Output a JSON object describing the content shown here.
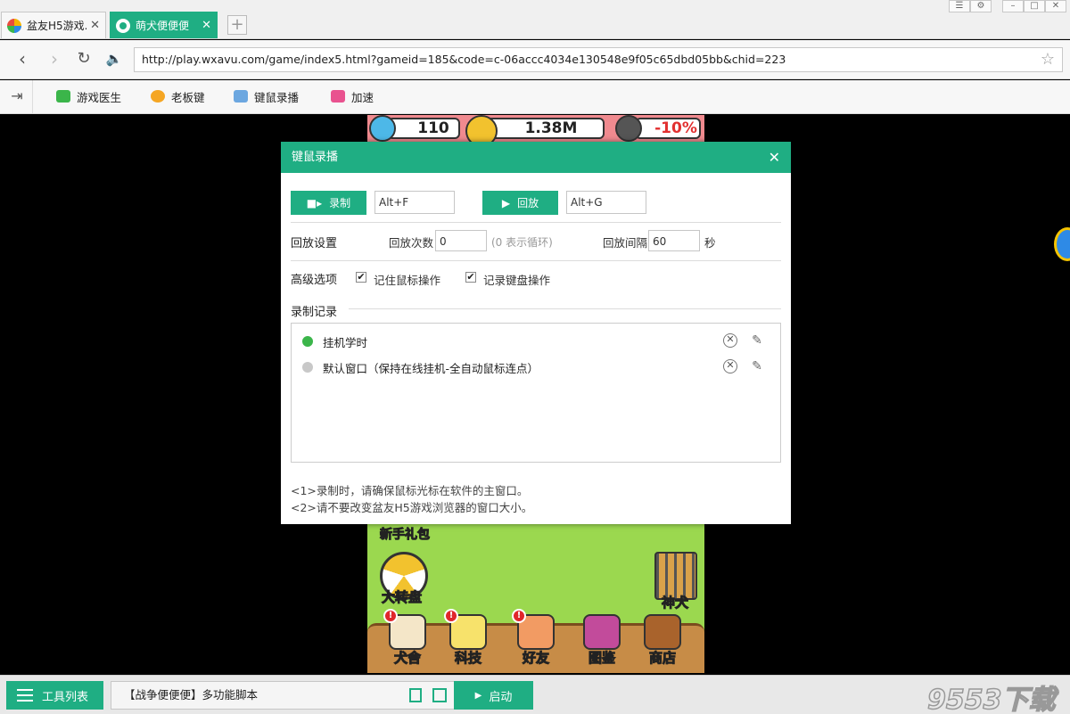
{
  "browser": {
    "tabs": [
      {
        "label": "盆友H5游戏..."
      },
      {
        "label": "萌犬便便便"
      }
    ],
    "url": "http://play.wxavu.com/game/index5.html?gameid=185&code=c-06accc4034e130548e9f05c65dbd05bb&chid=223",
    "toolbar": [
      {
        "label": "游戏医生",
        "icon": "medical-kit-icon"
      },
      {
        "label": "老板键",
        "icon": "eye-icon"
      },
      {
        "label": "键鼠录播",
        "icon": "keyboard-icon"
      },
      {
        "label": "加速",
        "icon": "gamepad-icon"
      }
    ]
  },
  "game": {
    "gems": "110",
    "coins": "1.38M",
    "bonus": "-10%",
    "gift_label": "新手礼包",
    "wheel_label": "大转盘",
    "cage_label": "神犬",
    "buttons": [
      {
        "label": "犬舍",
        "alert": true
      },
      {
        "label": "科技",
        "alert": true
      },
      {
        "label": "好友",
        "alert": true
      },
      {
        "label": "图鉴",
        "alert": false
      },
      {
        "label": "商店",
        "alert": false
      }
    ]
  },
  "dialog": {
    "title": "键鼠录播",
    "record_label": "录制",
    "record_hotkey": "Alt+F",
    "play_label": "回放",
    "play_hotkey": "Alt+G",
    "playback_settings_label": "回放设置",
    "playback_count_label": "回放次数",
    "playback_count_value": "0",
    "playback_count_hint": "(0 表示循环)",
    "playback_interval_label": "回放间隔",
    "playback_interval_value": "60",
    "playback_interval_unit": "秒",
    "advanced_label": "高级选项",
    "option_mouse": {
      "label": "记住鼠标操作",
      "checked": true
    },
    "option_keyboard": {
      "label": "记录键盘操作",
      "checked": true
    },
    "records_label": "录制记录",
    "records": [
      {
        "name": "挂机学时",
        "active": true
      },
      {
        "name": "默认窗口（保持在线挂机-全自动鼠标连点）",
        "active": false
      }
    ],
    "notes": [
      "<1>录制时，请确保鼠标光标在软件的主窗口。",
      "<2>请不要改变盆友H5游戏浏览器的窗口大小。"
    ]
  },
  "statusbar": {
    "tool_list_label": "工具列表",
    "script_name": "【战争便便便】多功能脚本",
    "start_label": "启动"
  },
  "watermark": "9553下载",
  "colors": {
    "accent": "#1fae83",
    "active_dot": "#3bb54a",
    "inactive_dot": "#c8c8c8"
  }
}
